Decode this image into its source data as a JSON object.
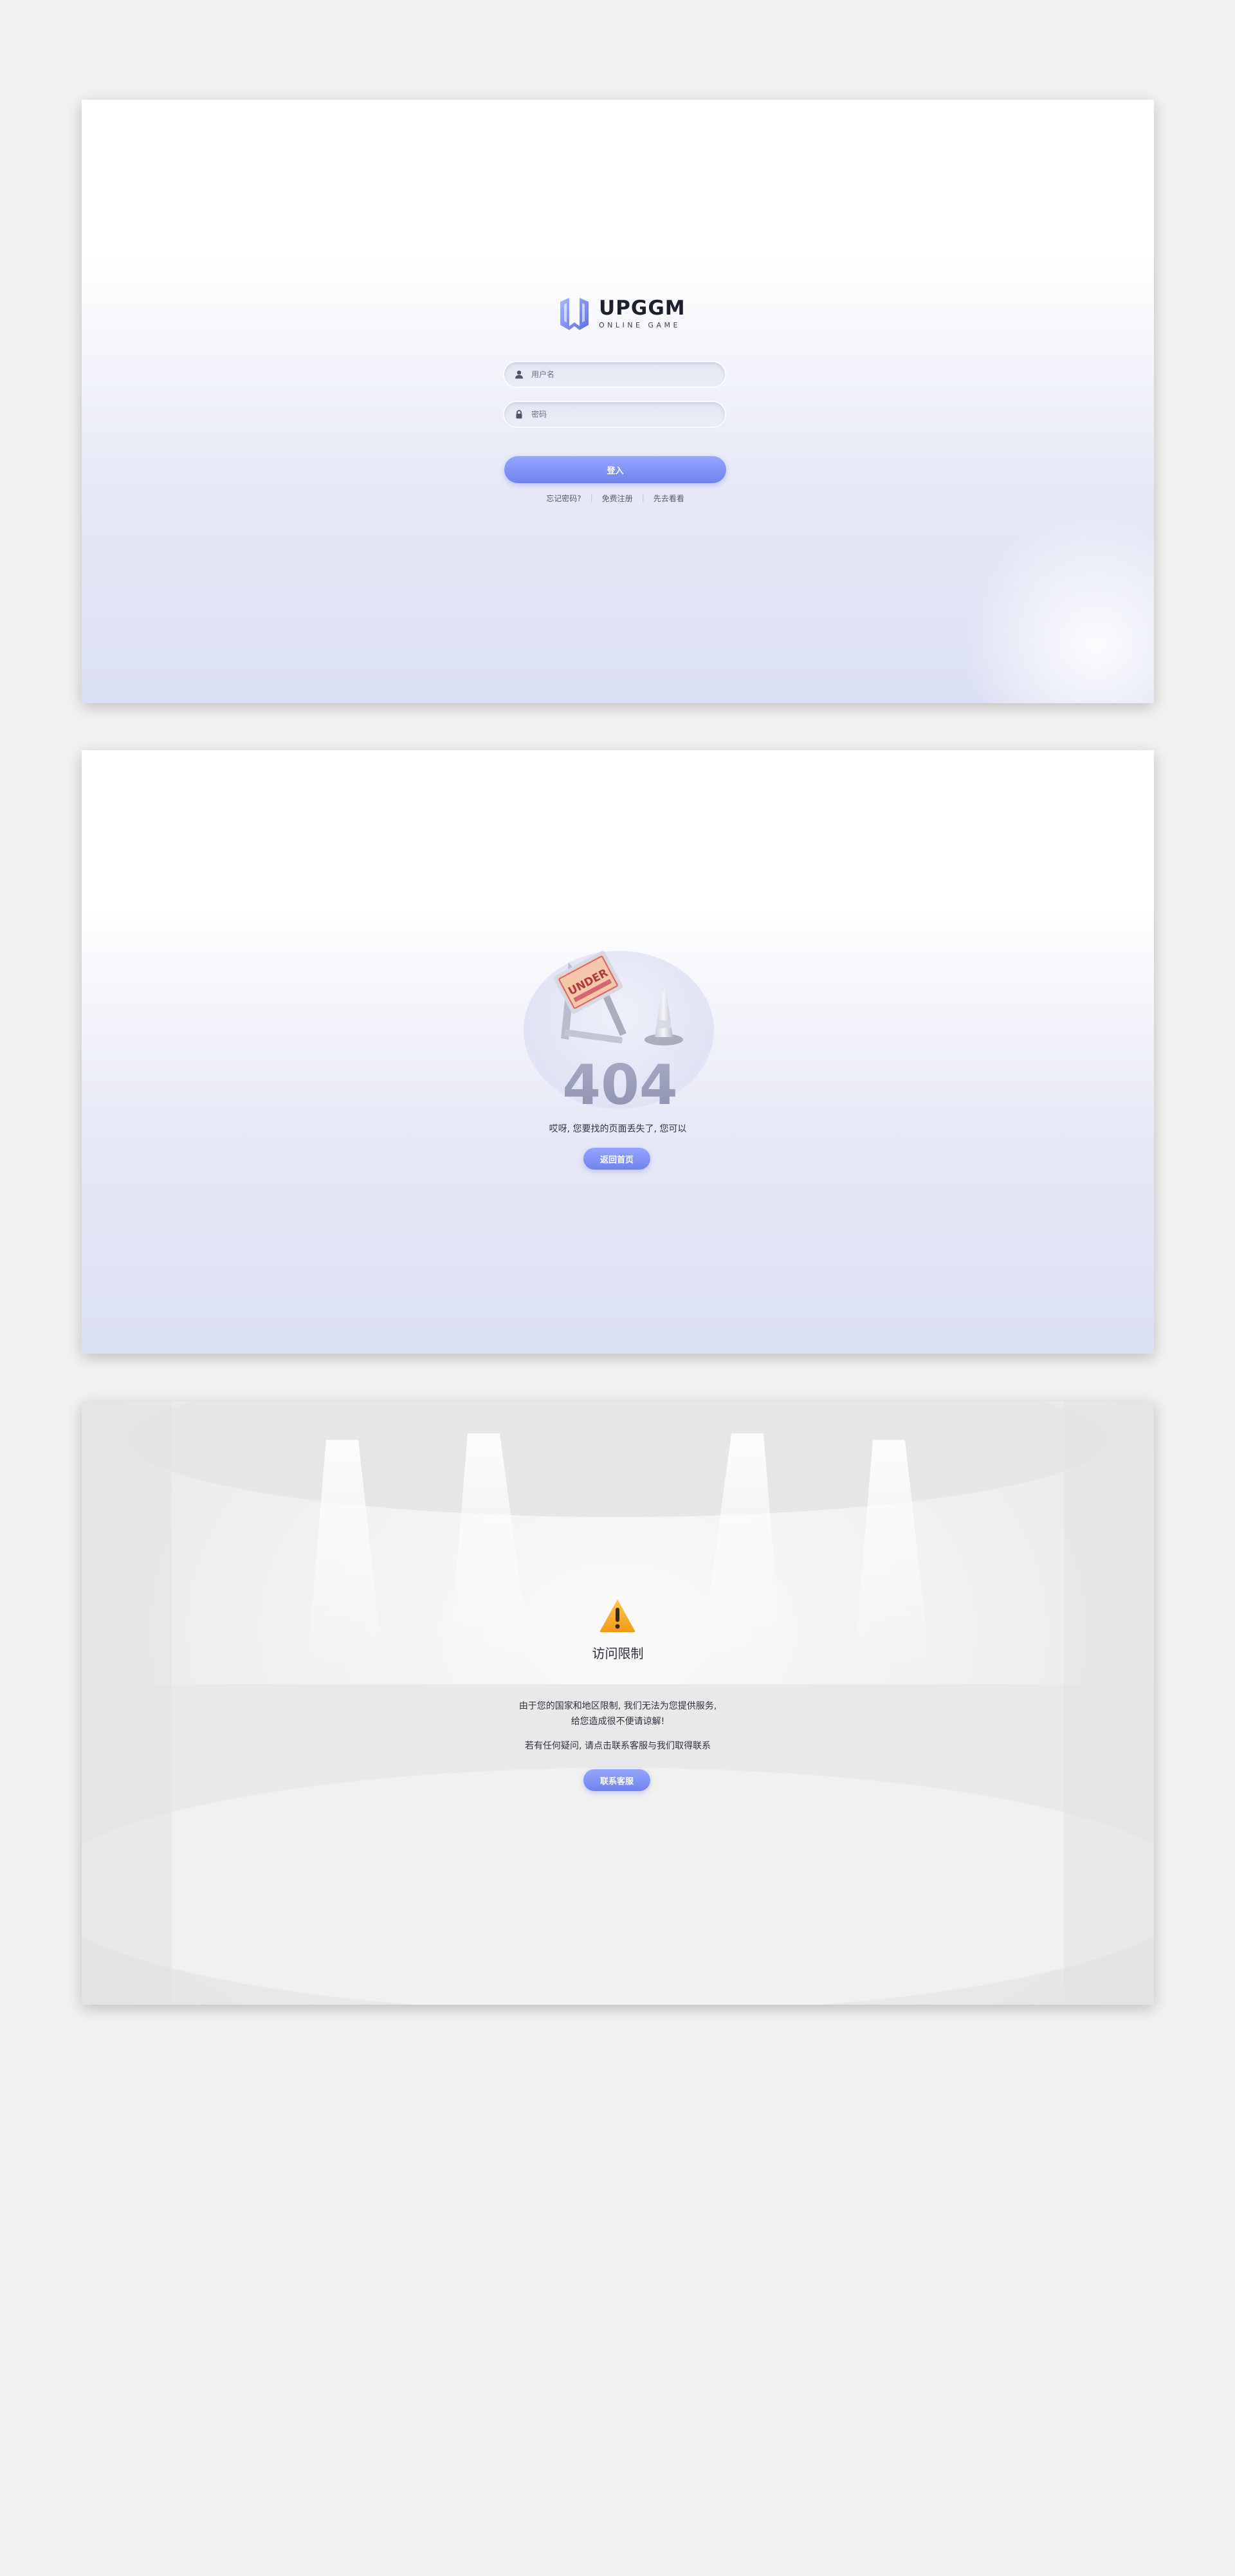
{
  "login": {
    "logo_title": "UPGGM",
    "logo_subtitle": "ONLINE GAME",
    "username_placeholder": "用户名",
    "password_placeholder": "密码",
    "login_button": "登入",
    "forgot_password": "忘记密码?",
    "register": "免费注册",
    "guest": "先去看看"
  },
  "not_found": {
    "sign_text": "UNDER",
    "big_code": "404",
    "message": "哎呀, 您要找的页面丢失了, 您可以",
    "back_home_button": "返回首页"
  },
  "restricted": {
    "title": "访问限制",
    "line1": "由于您的国家和地区限制, 我们无法为您提供服务,",
    "line2": "给您造成很不便请谅解!",
    "line3": "若有任何疑问, 请点击联系客服与我们取得联系",
    "contact_button": "联系客服"
  },
  "colors": {
    "accent": "#7b8ef3",
    "page_bg": "#f2f2f2"
  },
  "icons": {
    "user": "user-icon",
    "lock": "lock-icon",
    "warning": "warning-icon"
  }
}
